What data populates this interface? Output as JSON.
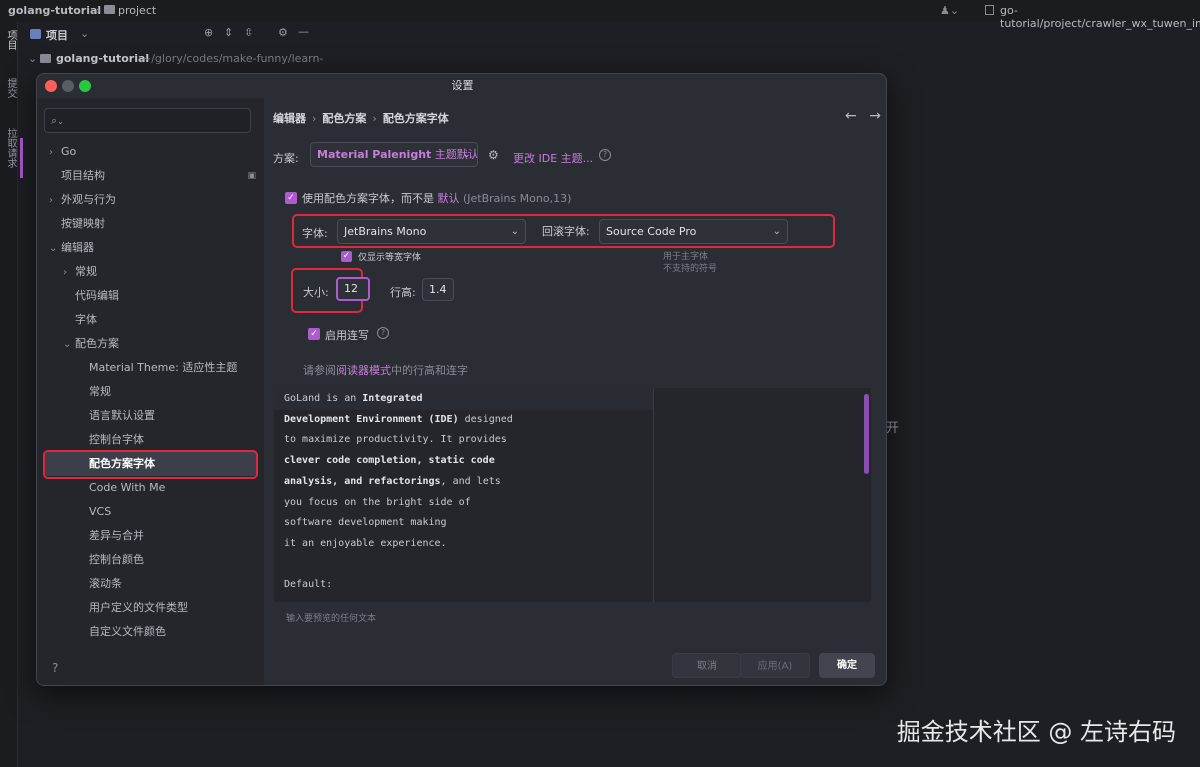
{
  "topbar": {
    "project_name": "golang-tutorial",
    "project_path": "project",
    "right_path": "go-tutorial/project/crawler_wx_tuwen_img"
  },
  "leftstrip": {
    "tab1": "项目",
    "tab2": "提交",
    "tab3": "拉取请求"
  },
  "projrow": {
    "label": "项目",
    "tree_root": "golang-tutorial",
    "tree_path": "~/glory/codes/make-funny/learn-"
  },
  "background_text": "开",
  "dialog": {
    "title": "设置",
    "search": {
      "placeholder": ""
    },
    "nav": [
      {
        "label": "Go",
        "chevron": "›",
        "indent": 0
      },
      {
        "label": "项目结构",
        "chevron": "",
        "indent": 0
      },
      {
        "label": "外观与行为",
        "chevron": "›",
        "indent": 0
      },
      {
        "label": "按键映射",
        "chevron": "",
        "indent": 0
      },
      {
        "label": "编辑器",
        "chevron": "⌄",
        "indent": 0
      },
      {
        "label": "常规",
        "chevron": "›",
        "indent": 1
      },
      {
        "label": "代码编辑",
        "chevron": "",
        "indent": 1
      },
      {
        "label": "字体",
        "chevron": "",
        "indent": 1
      },
      {
        "label": "配色方案",
        "chevron": "⌄",
        "indent": 1
      },
      {
        "label": "Material Theme: 适应性主题",
        "chevron": "",
        "indent": 2
      },
      {
        "label": "常规",
        "chevron": "",
        "indent": 2
      },
      {
        "label": "语言默认设置",
        "chevron": "",
        "indent": 2
      },
      {
        "label": "控制台字体",
        "chevron": "",
        "indent": 2
      },
      {
        "label": "配色方案字体",
        "chevron": "",
        "indent": 2
      },
      {
        "label": "Code With Me",
        "chevron": "",
        "indent": 2
      },
      {
        "label": "VCS",
        "chevron": "",
        "indent": 2
      },
      {
        "label": "差异与合并",
        "chevron": "",
        "indent": 2
      },
      {
        "label": "控制台颜色",
        "chevron": "",
        "indent": 2
      },
      {
        "label": "滚动条",
        "chevron": "",
        "indent": 2
      },
      {
        "label": "用户定义的文件类型",
        "chevron": "",
        "indent": 2
      },
      {
        "label": "自定义文件颜色",
        "chevron": "",
        "indent": 2
      }
    ],
    "selected_nav": "配色方案字体",
    "help": "?",
    "breadcrumb": [
      "编辑器",
      "配色方案",
      "配色方案字体"
    ],
    "scheme": {
      "label": "方案:",
      "value_bold": "Material Palenight",
      "value_suffix": " 主题默认",
      "change_link": "更改 IDE 主题..."
    },
    "use_scheme_font": {
      "checked": true,
      "text": "使用配色方案字体，而不是",
      "link": "默认",
      "suffix": "(JetBrains Mono,13)"
    },
    "font": {
      "label": "字体:",
      "value": "JetBrains Mono"
    },
    "fallback": {
      "label": "回滚字体:",
      "value": "Source Code Pro"
    },
    "fallback_hint": [
      "用于主字体",
      "不支持的符号"
    ],
    "monospace_only": {
      "checked": true,
      "text": "仅显示等宽字体"
    },
    "size": {
      "label": "大小:",
      "value": "12"
    },
    "line_height": {
      "label": "行高:",
      "value": "1.4"
    },
    "ligatures": {
      "checked": true,
      "text": "启用连写"
    },
    "reader_note": {
      "pre": "请参阅",
      "link": "阅读器模式",
      "post": "中的行高和连字"
    },
    "preview_lines": [
      [
        "GoLand is an ",
        "Integrated",
        ""
      ],
      [
        "",
        "Development Environment (IDE)",
        " designed"
      ],
      [
        "to maximize productivity. It provides",
        "",
        ""
      ],
      [
        "",
        "clever code completion, static code",
        ""
      ],
      [
        "",
        "analysis, and refactorings",
        ", and lets"
      ],
      [
        "you focus on the bright side of",
        "",
        ""
      ],
      [
        "software development making",
        "",
        ""
      ],
      [
        "it an enjoyable experience.",
        "",
        ""
      ],
      [
        "",
        "",
        ""
      ],
      [
        "Default:",
        "",
        ""
      ]
    ],
    "preview_placeholder": "输入要预览的任何文本",
    "buttons": {
      "cancel": "取消",
      "apply": "应用(A)",
      "ok": "确定"
    }
  },
  "watermark": "掘金技术社区 @ 左诗右码",
  "colors": {
    "accent": "#b05ad0",
    "link": "#c77ddb",
    "highlight_box": "#e0283a",
    "selected_bg": "#3c3f49"
  }
}
